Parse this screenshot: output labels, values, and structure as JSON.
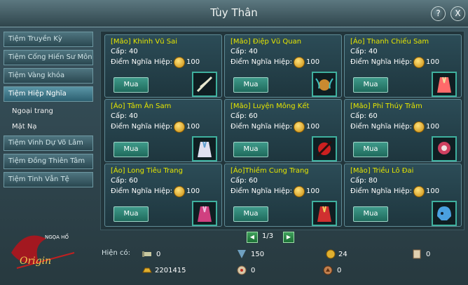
{
  "window": {
    "title": "Tùy Thân",
    "help_label": "?",
    "close_label": "X"
  },
  "sidebar": {
    "items": [
      {
        "label": "Tiệm Truyền Kỳ",
        "active": false
      },
      {
        "label": "Tiệm Cống Hiến Sư Môn",
        "active": false
      },
      {
        "label": "Tiệm Vàng khóa",
        "active": false
      },
      {
        "label": "Tiệm Hiệp Nghĩa",
        "active": true
      },
      {
        "label": "Tiệm Vinh Dự Võ Lâm",
        "active": false
      },
      {
        "label": "Tiệm Đồng Thiên Tâm",
        "active": false
      },
      {
        "label": "Tiệm Tinh Vẫn Tệ",
        "active": false
      }
    ],
    "subitems": [
      "Ngoại   trang",
      "Mặt Nạ"
    ]
  },
  "logo": {
    "text": "Origin",
    "badge": "NGỌA HỔ"
  },
  "shop": {
    "level_prefix": "Cấp: ",
    "points_label": "Điểm Nghĩa Hiệp:",
    "buy_label": "Mua",
    "items": [
      {
        "name": "[Mão] Khinh Vũ Sai",
        "level": "40",
        "price": "100",
        "icon": "feather-hairpin-icon",
        "color": "#e8e8d0"
      },
      {
        "name": "[Mão] Điệp Vũ Quan",
        "level": "40",
        "price": "100",
        "icon": "butterfly-crown-icon",
        "color": "#e0a040"
      },
      {
        "name": "[Áo] Thanh Chiếu Sam",
        "level": "40",
        "price": "100",
        "icon": "robe-icon",
        "color": "#ff6a6a"
      },
      {
        "name": "[Áo] Tâm Ân Sam",
        "level": "40",
        "price": "100",
        "icon": "robe-icon",
        "color": "#e0e0f0"
      },
      {
        "name": "[Mão] Luyện Mông Kết",
        "level": "60",
        "price": "100",
        "icon": "hairpin-icon",
        "color": "#cc2020"
      },
      {
        "name": "[Mão] Phỉ Thúy Trâm",
        "level": "60",
        "price": "100",
        "icon": "jade-hairpin-icon",
        "color": "#d04060"
      },
      {
        "name": "[Áo] Long Tiêu Trang",
        "level": "60",
        "price": "100",
        "icon": "robe-icon",
        "color": "#d04080"
      },
      {
        "name": "[Áo]Thiềm Cung Trang",
        "level": "60",
        "price": "100",
        "icon": "robe-icon",
        "color": "#d03030"
      },
      {
        "name": "[Mão] Triều Lô Đai",
        "level": "80",
        "price": "100",
        "icon": "helmet-icon",
        "color": "#4aa0e0"
      }
    ]
  },
  "pagination": {
    "text": "1/3"
  },
  "footer": {
    "label": "Hiện có:",
    "currencies": [
      {
        "icon": "scroll-icon",
        "value": "0"
      },
      {
        "icon": "badge-icon",
        "value": "150"
      },
      {
        "icon": "gold-coin-icon",
        "value": "24"
      },
      {
        "icon": "paper-icon",
        "value": "0"
      },
      {
        "icon": "gold-ingot-icon",
        "value": "2201415"
      },
      {
        "icon": "medal-icon",
        "value": "0"
      },
      {
        "icon": "copper-coin-icon",
        "value": "0"
      }
    ]
  }
}
